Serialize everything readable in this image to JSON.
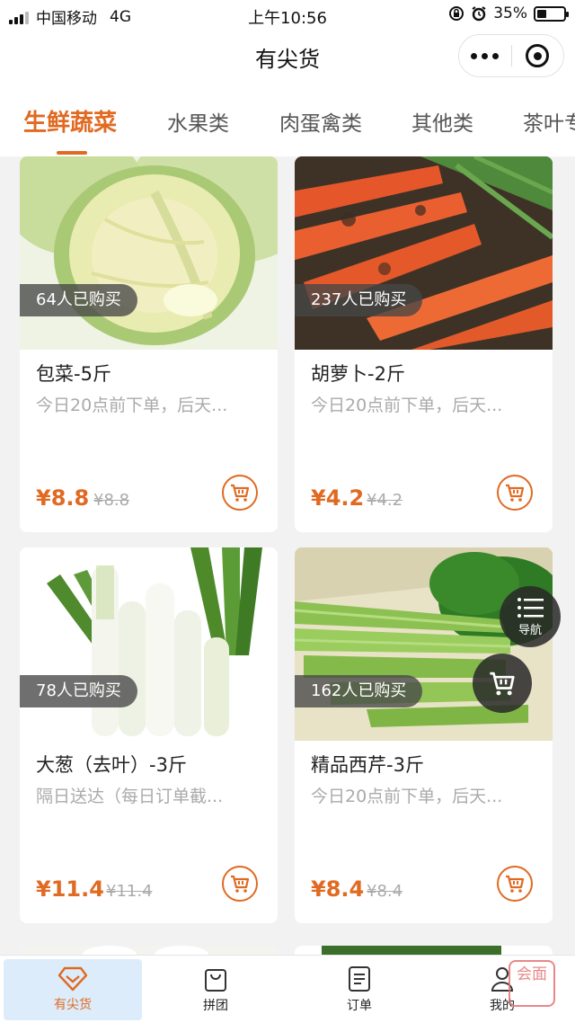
{
  "status_bar": {
    "carrier": "中国移动",
    "network": "4G",
    "time": "上午10:56",
    "battery": "35%",
    "battery_level": 0.35
  },
  "nav": {
    "title": "有尖货"
  },
  "tabs": [
    {
      "label": "生鲜蔬菜",
      "active": true
    },
    {
      "label": "水果类",
      "active": false
    },
    {
      "label": "肉蛋禽类",
      "active": false
    },
    {
      "label": "其他类",
      "active": false
    },
    {
      "label": "茶叶专",
      "active": false
    }
  ],
  "products": [
    {
      "title": "包菜-5斤",
      "buyers": "64人已购买",
      "desc": "今日20点前下单，后天...",
      "price": "¥8.8",
      "original_price": "¥8.8",
      "image": "cabbage"
    },
    {
      "title": "胡萝卜-2斤",
      "buyers": "237人已购买",
      "desc": "今日20点前下单，后天...",
      "price": "¥4.2",
      "original_price": "¥4.2",
      "image": "carrot"
    },
    {
      "title": "大葱（去叶）-3斤",
      "buyers": "78人已购买",
      "desc": "隔日送达（每日订单截...",
      "price": "¥11.4",
      "original_price": "¥11.4",
      "image": "scallion"
    },
    {
      "title": "精品西芹-3斤",
      "buyers": "162人已购买",
      "desc": "今日20点前下单，后天...",
      "price": "¥8.4",
      "original_price": "¥8.4",
      "image": "celery"
    }
  ],
  "floating": {
    "nav_label": "导航"
  },
  "tabbar": [
    {
      "label": "有尖货",
      "icon": "diamond-icon",
      "active": true
    },
    {
      "label": "拼团",
      "icon": "bag-icon",
      "active": false
    },
    {
      "label": "订单",
      "icon": "document-icon",
      "active": false
    },
    {
      "label": "我的",
      "icon": "user-icon",
      "active": false
    }
  ],
  "watermark": "会面",
  "colors": {
    "accent": "#e06a22",
    "tab_active_bg": "#dcecfb"
  }
}
